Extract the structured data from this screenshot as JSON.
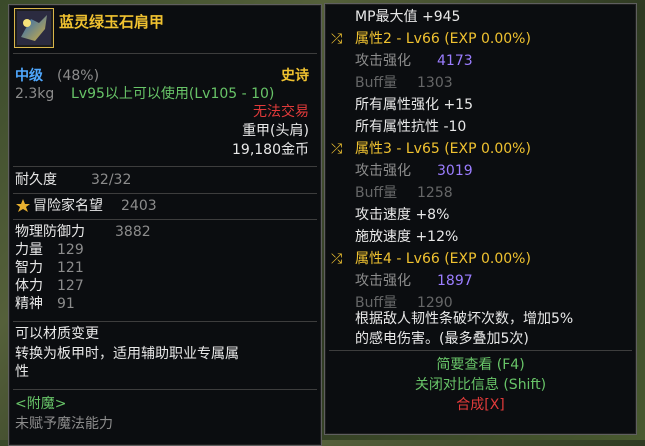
{
  "item": {
    "name": "蓝灵绿玉石肩甲",
    "grade": "中级",
    "grade_pct": "(48%)",
    "rarity": "史诗",
    "weight": "2.3kg",
    "level_req": "Lv95以上可以使用(Lv105 - 10)",
    "trade": "无法交易",
    "type": "重甲(头肩)",
    "price": "19,180金币",
    "durability_label": "耐久度",
    "durability_value": "32/32",
    "fame_label": "冒险家名望",
    "fame_value": "2403",
    "stats": [
      {
        "label": "物理防御力",
        "value": "3882"
      },
      {
        "label": "力量",
        "value": "129"
      },
      {
        "label": "智力",
        "value": "121"
      },
      {
        "label": "体力",
        "value": "127"
      },
      {
        "label": "精神",
        "value": "91"
      }
    ],
    "material_change": "可以材质变更",
    "convert_line1": "转换为板甲时，适用辅助职业专属属",
    "convert_line2": "性",
    "enchant_label": "<附魔>",
    "enchant_value": "未赋予魔法能力"
  },
  "right": {
    "mp_line": "MP最大值 +945",
    "attr2_title": "属性2 - Lv66 (EXP 0.00%)",
    "attr2_atk_label": "攻击强化",
    "attr2_atk": "4173",
    "attr2_buff_label": "Buff量",
    "attr2_buff": "1303",
    "all_attr_enh": "所有属性强化 +15",
    "all_attr_res": "所有属性抗性 -10",
    "attr3_title": "属性3 - Lv65 (EXP 0.00%)",
    "attr3_atk_label": "攻击强化",
    "attr3_atk": "3019",
    "attr3_buff_label": "Buff量",
    "attr3_buff": "1258",
    "atk_speed": "攻击速度 +8%",
    "cast_speed": "施放速度 +12%",
    "attr4_title": "属性4 - Lv66 (EXP 0.00%)",
    "attr4_atk_label": "攻击强化",
    "attr4_atk": "1897",
    "attr4_buff_label": "Buff量",
    "attr4_buff": "1290",
    "desc_line1": "根据敌人韧性条破坏次数，增加5%",
    "desc_line2": "的感电伤害。(最多叠加5次)",
    "brief_view": "简要查看 (F4)",
    "close_compare": "关闭对比信息 (Shift)",
    "synthesize": "合成[X]"
  }
}
